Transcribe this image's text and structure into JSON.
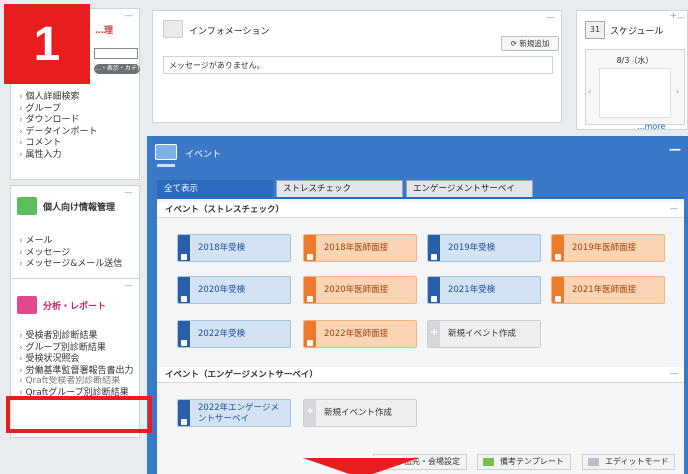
{
  "badge": "1",
  "sidebar": {
    "search_btn": "…・表示・カテ)",
    "top_title": "…理",
    "box1_items": [
      "個人詳細検索",
      "グループ",
      "ダウンロード",
      "データインポート",
      "コメント",
      "属性入力"
    ],
    "box2_title": "個人向け情報管理",
    "box2_items": [
      "メール",
      "メッセージ",
      "メッセージ&メール送信"
    ],
    "box3_title": "分析・レポート",
    "box3_items": [
      "受検者別診断結果",
      "グループ別診断結果",
      "受検状況照会",
      "労働基準監督署報告書出力",
      "Qraft受検者別診断結果",
      "Qraftグループ別診断結果"
    ]
  },
  "info": {
    "title": "インフォメーション",
    "add_button": "新規追加",
    "message": "メッセージがありません。"
  },
  "schedule": {
    "title": "スケジュール",
    "icon_day": "31",
    "date": "8/3（水）",
    "more": "...more"
  },
  "event": {
    "title": "イベント",
    "tabs": [
      "全て表示",
      "ストレスチェック",
      "エンゲージメントサーベイ"
    ],
    "stress_section": "イベント（ストレスチェック）",
    "stress_buttons": [
      {
        "label": "2018年受検",
        "color": "blue"
      },
      {
        "label": "2018年医師面接",
        "color": "orange"
      },
      {
        "label": "2019年受検",
        "color": "blue"
      },
      {
        "label": "2019年医師面接",
        "color": "orange"
      },
      {
        "label": "2020年受検",
        "color": "blue"
      },
      {
        "label": "2020年医師面接",
        "color": "orange"
      },
      {
        "label": "2021年受検",
        "color": "blue"
      },
      {
        "label": "2021年医師面接",
        "color": "orange"
      },
      {
        "label": "2022年受検",
        "color": "blue"
      },
      {
        "label": "2022年医師面接",
        "color": "orange"
      },
      {
        "label": "新規イベント作成",
        "color": "gray"
      }
    ],
    "engage_section": "イベント（エンゲージメントサーベイ）",
    "engage_buttons": [
      {
        "label_line1": "2022年エンゲージメ",
        "label_line2": "ントサーベイ",
        "color": "blue"
      },
      {
        "label": "新規イベント作成",
        "color": "gray"
      }
    ],
    "bottom_buttons": [
      "単出先・会場設定",
      "備考テンプレート",
      "エディットモード"
    ]
  }
}
